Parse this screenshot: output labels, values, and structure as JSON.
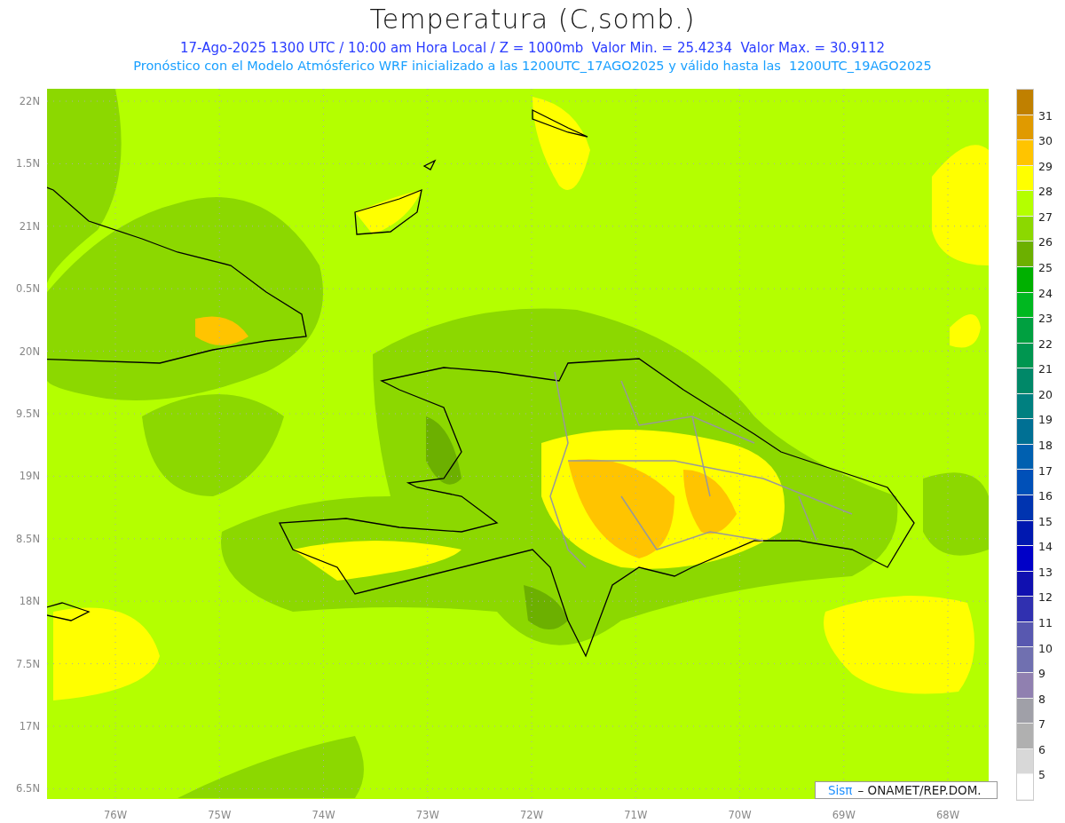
{
  "title": "Temperatura (C,somb.)",
  "subtitle": "17-Ago-2025 1300 UTC / 10:00 am Hora Local / Z = 1000mb  Valor Min. = 25.4234  Valor Max. = 30.9112",
  "subtitle_2": "Pronóstico con el Modelo Atmósferico WRF inicializado a las 1200UTC_17AGO2025 y válido hasta las  1200UTC_19AGO2025",
  "map": {
    "y_axis_labels": [
      "22N",
      "1.5N",
      "21N",
      "0.5N",
      "20N",
      "9.5N",
      "19N",
      "8.5N",
      "18N",
      "7.5N",
      "17N",
      "6.5N"
    ],
    "x_axis_labels": [
      "76W",
      "75W",
      "74W",
      "73W",
      "72W",
      "71W",
      "70W",
      "69W",
      "68W"
    ]
  },
  "legend": [
    {
      "color": "#c08000",
      "label": "31"
    },
    {
      "color": "#e09a00",
      "label": "30"
    },
    {
      "color": "#ffc400",
      "label": "29"
    },
    {
      "color": "#ffff00",
      "label": "28"
    },
    {
      "color": "#b4ff00",
      "label": "27"
    },
    {
      "color": "#8cd800",
      "label": "26"
    },
    {
      "color": "#6cb000",
      "label": "25"
    },
    {
      "color": "#00b000",
      "label": "24"
    },
    {
      "color": "#00b820",
      "label": "23"
    },
    {
      "color": "#00a040",
      "label": "22"
    },
    {
      "color": "#009650",
      "label": "21"
    },
    {
      "color": "#008868",
      "label": "20"
    },
    {
      "color": "#008080",
      "label": "19"
    },
    {
      "color": "#007094",
      "label": "18"
    },
    {
      "color": "#0060b0",
      "label": "17"
    },
    {
      "color": "#0050b8",
      "label": "16"
    },
    {
      "color": "#0034b0",
      "label": "15"
    },
    {
      "color": "#0018b0",
      "label": "14"
    },
    {
      "color": "#0000c8",
      "label": "13"
    },
    {
      "color": "#1010b0",
      "label": "12"
    },
    {
      "color": "#3030b0",
      "label": "11"
    },
    {
      "color": "#5858b0",
      "label": "10"
    },
    {
      "color": "#7070b0",
      "label": "9"
    },
    {
      "color": "#9080b0",
      "label": "8"
    },
    {
      "color": "#a0a0a8",
      "label": "7"
    },
    {
      "color": "#b0b0b0",
      "label": "6"
    },
    {
      "color": "#d8d8d8",
      "label": "5"
    },
    {
      "color": "#ffffff"
    }
  ],
  "credit": {
    "logo": "Sisπ",
    "text": "– ONAMET/REP.DOM."
  }
}
